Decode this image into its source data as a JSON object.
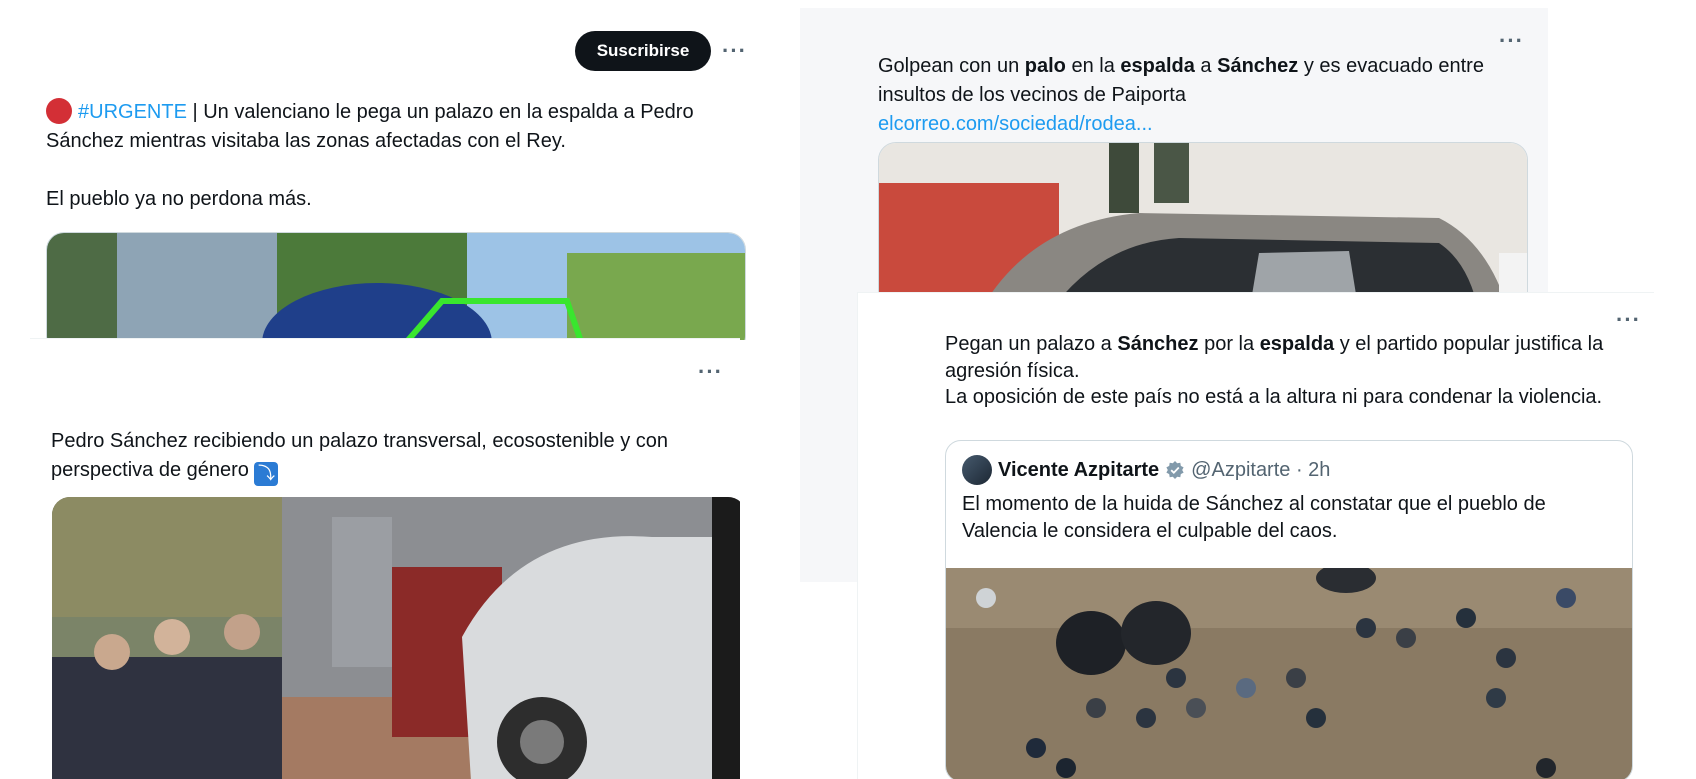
{
  "tweet1": {
    "subscribe_label": "Suscribirse",
    "more": "···",
    "hashtag": "#URGENTE",
    "text_a": " | Un valenciano le pega un palazo en la espalda a Pedro Sánchez mientras visitaba las zonas afectadas con el Rey.",
    "text_b": "El pueblo ya no perdona más."
  },
  "tweet2": {
    "more": "···",
    "text": "Pedro Sánchez recibiendo un palazo transversal, ecosostenible y con perspectiva de género",
    "emoji": "⤵"
  },
  "tweet3": {
    "more": "···",
    "t1": "Golpean con un ",
    "b1": "palo",
    "t2": " en la ",
    "b2": "espalda",
    "t3": " a ",
    "b3": "Sánchez",
    "t4": " y es evacuado entre insultos de los vecinos de Paiporta",
    "link": "elcorreo.com/sociedad/rodea..."
  },
  "tweet4": {
    "more": "···",
    "t1": "Pegan un palazo a ",
    "b1": "Sánchez",
    "t2": " por la ",
    "b2": "espalda",
    "t3": " y el partido popular justifica la agresión física.",
    "t4": "La oposición de este país no está a la altura ni para condenar la violencia.",
    "quote": {
      "name": "Vicente Azpitarte",
      "handle": "@Azpitarte · 2h",
      "text": "El momento de la huida de Sánchez al constatar que el pueblo de Valencia le considera el culpable del caos."
    }
  },
  "colors": {
    "link": "#1d9bf0",
    "subscribe_bg": "#0f1419",
    "urgent_dot": "#d32f36"
  }
}
